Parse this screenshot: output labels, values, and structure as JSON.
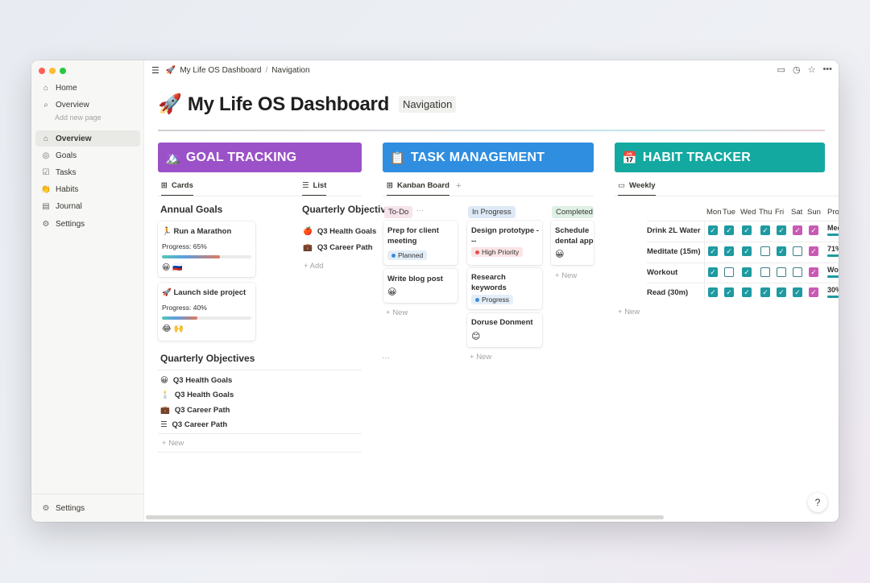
{
  "breadcrumb": {
    "emoji": "🚀",
    "page": "My Life OS Dashboard",
    "sub": "Navigation"
  },
  "sidebar": {
    "top_items": [
      {
        "label": "Home",
        "icon": "⌂"
      },
      {
        "label": "Overview",
        "icon": "⌕"
      }
    ],
    "add_page": "Add new page",
    "items": [
      {
        "label": "Overview",
        "icon": "⌂"
      },
      {
        "label": "Goals",
        "icon": "◎"
      },
      {
        "label": "Tasks",
        "icon": "☑"
      },
      {
        "label": "Habits",
        "icon": "👏"
      },
      {
        "label": "Journal",
        "icon": "▤"
      },
      {
        "label": "Settings",
        "icon": "⚙"
      }
    ],
    "bottom": {
      "label": "Settings",
      "icon": "⚙"
    }
  },
  "page": {
    "emoji": "🚀",
    "title": "My Life OS Dashboard",
    "nav_chip": "Navigation"
  },
  "goal": {
    "emoji": "🏔️",
    "title": "GOAL TRACKING",
    "color": "#9b51c8",
    "tabs": [
      {
        "label": "Cards",
        "icon": "⊞"
      },
      {
        "label": "List",
        "icon": "☰"
      }
    ],
    "annual": "Annual Goals",
    "cards": [
      {
        "emoji": "🏃",
        "title": "Run a Marathon",
        "progress_text": "Progress: 65%",
        "progress": 0.65,
        "icons": "😀 🇷🇺"
      },
      {
        "emoji": "🚀",
        "title": "Launch side project",
        "progress_text": "Progress: 40%",
        "progress": 0.4,
        "icons": "😂 🙌"
      }
    ],
    "list_head": "Quarterly Objectives",
    "list_items": [
      {
        "emoji": "🍎",
        "label": "Q3 Health Goals"
      },
      {
        "emoji": "💼",
        "label": "Q3 Career Path"
      }
    ],
    "add": "Add",
    "quarterly": "Quarterly Objectives",
    "more": "···",
    "quarterly_items": [
      {
        "emoji": "😀",
        "label": "Q3 Health Goals"
      },
      {
        "emoji": "🕯️",
        "label": "Q3 Health Goals"
      },
      {
        "emoji": "💼",
        "label": "Q3 Career Path"
      },
      {
        "emoji": "☰",
        "label": "Q3 Career Path"
      }
    ],
    "new": "New"
  },
  "task": {
    "emoji": "📋",
    "title": "TASK MANAGEMENT",
    "color": "#2f8ee0",
    "tab": {
      "label": "Kanban Board",
      "icon": "⊞"
    },
    "plus": "+",
    "columns": [
      {
        "label": "To-Do",
        "bg": "#f7e3ec",
        "more": "···"
      },
      {
        "label": "In Progress",
        "bg": "#dde9f7"
      },
      {
        "label": "Completed",
        "bg": "#dff0e4"
      }
    ],
    "todo": [
      {
        "title": "Prep for client meeting",
        "badge": "Planned",
        "badge_bg": "#e3eef9",
        "dot": "#3d8ad8"
      },
      {
        "title": "Write blog post",
        "emoji": "😀"
      }
    ],
    "inprogress": [
      {
        "title": "Design prototype ---",
        "badge": "High Priority",
        "badge_bg": "#fbe4e4",
        "dot": "#e05050"
      },
      {
        "title": "Research keywords",
        "badge": "Progress",
        "badge_bg": "#e3eef9",
        "dot": "#3d8ad8"
      },
      {
        "title": "Doruse Donment",
        "emoji": "😊"
      }
    ],
    "completed": [
      {
        "title": "Schedule dental app",
        "emoji": "😀"
      }
    ],
    "new": "New"
  },
  "habit": {
    "emoji": "📅",
    "title": "HABIT TRACKER",
    "color": "#14a9a0",
    "tab": {
      "label": "Weekly",
      "icon": "▭"
    },
    "days": [
      "Mon",
      "Tue",
      "Wed",
      "Thu",
      "Fri",
      "Sat",
      "Sun"
    ],
    "progress_label": "Progress",
    "rows": [
      {
        "name": "Drink 2L Water",
        "checks": [
          1,
          1,
          1,
          1,
          1,
          1,
          1
        ],
        "pink": [
          0,
          0,
          0,
          0,
          0,
          1,
          1
        ],
        "progress": "Meditate"
      },
      {
        "name": "Meditate (15m)",
        "checks": [
          1,
          1,
          1,
          0,
          1,
          0,
          1
        ],
        "pink": [
          0,
          0,
          0,
          0,
          0,
          0,
          1
        ],
        "progress": "71%"
      },
      {
        "name": "Workout",
        "checks": [
          1,
          0,
          1,
          0,
          0,
          0,
          1
        ],
        "pink": [
          0,
          0,
          0,
          0,
          0,
          0,
          1
        ],
        "progress": "Workout"
      },
      {
        "name": "Read (30m)",
        "checks": [
          1,
          1,
          1,
          1,
          1,
          1,
          1
        ],
        "pink": [
          0,
          0,
          0,
          0,
          0,
          0,
          1
        ],
        "progress": "30%"
      }
    ],
    "new": "New"
  },
  "help": "?"
}
